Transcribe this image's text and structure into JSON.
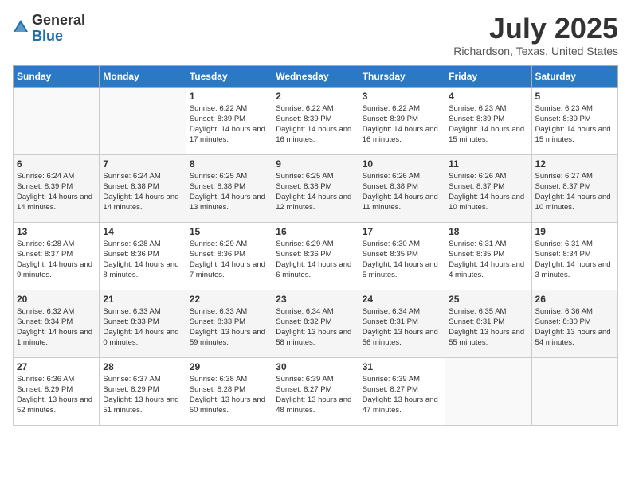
{
  "header": {
    "logo_general": "General",
    "logo_blue": "Blue",
    "month_title": "July 2025",
    "location": "Richardson, Texas, United States"
  },
  "weekdays": [
    "Sunday",
    "Monday",
    "Tuesday",
    "Wednesday",
    "Thursday",
    "Friday",
    "Saturday"
  ],
  "weeks": [
    [
      {
        "day": "",
        "info": ""
      },
      {
        "day": "",
        "info": ""
      },
      {
        "day": "1",
        "info": "Sunrise: 6:22 AM\nSunset: 8:39 PM\nDaylight: 14 hours and 17 minutes."
      },
      {
        "day": "2",
        "info": "Sunrise: 6:22 AM\nSunset: 8:39 PM\nDaylight: 14 hours and 16 minutes."
      },
      {
        "day": "3",
        "info": "Sunrise: 6:22 AM\nSunset: 8:39 PM\nDaylight: 14 hours and 16 minutes."
      },
      {
        "day": "4",
        "info": "Sunrise: 6:23 AM\nSunset: 8:39 PM\nDaylight: 14 hours and 15 minutes."
      },
      {
        "day": "5",
        "info": "Sunrise: 6:23 AM\nSunset: 8:39 PM\nDaylight: 14 hours and 15 minutes."
      }
    ],
    [
      {
        "day": "6",
        "info": "Sunrise: 6:24 AM\nSunset: 8:39 PM\nDaylight: 14 hours and 14 minutes."
      },
      {
        "day": "7",
        "info": "Sunrise: 6:24 AM\nSunset: 8:38 PM\nDaylight: 14 hours and 14 minutes."
      },
      {
        "day": "8",
        "info": "Sunrise: 6:25 AM\nSunset: 8:38 PM\nDaylight: 14 hours and 13 minutes."
      },
      {
        "day": "9",
        "info": "Sunrise: 6:25 AM\nSunset: 8:38 PM\nDaylight: 14 hours and 12 minutes."
      },
      {
        "day": "10",
        "info": "Sunrise: 6:26 AM\nSunset: 8:38 PM\nDaylight: 14 hours and 11 minutes."
      },
      {
        "day": "11",
        "info": "Sunrise: 6:26 AM\nSunset: 8:37 PM\nDaylight: 14 hours and 10 minutes."
      },
      {
        "day": "12",
        "info": "Sunrise: 6:27 AM\nSunset: 8:37 PM\nDaylight: 14 hours and 10 minutes."
      }
    ],
    [
      {
        "day": "13",
        "info": "Sunrise: 6:28 AM\nSunset: 8:37 PM\nDaylight: 14 hours and 9 minutes."
      },
      {
        "day": "14",
        "info": "Sunrise: 6:28 AM\nSunset: 8:36 PM\nDaylight: 14 hours and 8 minutes."
      },
      {
        "day": "15",
        "info": "Sunrise: 6:29 AM\nSunset: 8:36 PM\nDaylight: 14 hours and 7 minutes."
      },
      {
        "day": "16",
        "info": "Sunrise: 6:29 AM\nSunset: 8:36 PM\nDaylight: 14 hours and 6 minutes."
      },
      {
        "day": "17",
        "info": "Sunrise: 6:30 AM\nSunset: 8:35 PM\nDaylight: 14 hours and 5 minutes."
      },
      {
        "day": "18",
        "info": "Sunrise: 6:31 AM\nSunset: 8:35 PM\nDaylight: 14 hours and 4 minutes."
      },
      {
        "day": "19",
        "info": "Sunrise: 6:31 AM\nSunset: 8:34 PM\nDaylight: 14 hours and 3 minutes."
      }
    ],
    [
      {
        "day": "20",
        "info": "Sunrise: 6:32 AM\nSunset: 8:34 PM\nDaylight: 14 hours and 1 minute."
      },
      {
        "day": "21",
        "info": "Sunrise: 6:33 AM\nSunset: 8:33 PM\nDaylight: 14 hours and 0 minutes."
      },
      {
        "day": "22",
        "info": "Sunrise: 6:33 AM\nSunset: 8:33 PM\nDaylight: 13 hours and 59 minutes."
      },
      {
        "day": "23",
        "info": "Sunrise: 6:34 AM\nSunset: 8:32 PM\nDaylight: 13 hours and 58 minutes."
      },
      {
        "day": "24",
        "info": "Sunrise: 6:34 AM\nSunset: 8:31 PM\nDaylight: 13 hours and 56 minutes."
      },
      {
        "day": "25",
        "info": "Sunrise: 6:35 AM\nSunset: 8:31 PM\nDaylight: 13 hours and 55 minutes."
      },
      {
        "day": "26",
        "info": "Sunrise: 6:36 AM\nSunset: 8:30 PM\nDaylight: 13 hours and 54 minutes."
      }
    ],
    [
      {
        "day": "27",
        "info": "Sunrise: 6:36 AM\nSunset: 8:29 PM\nDaylight: 13 hours and 52 minutes."
      },
      {
        "day": "28",
        "info": "Sunrise: 6:37 AM\nSunset: 8:29 PM\nDaylight: 13 hours and 51 minutes."
      },
      {
        "day": "29",
        "info": "Sunrise: 6:38 AM\nSunset: 8:28 PM\nDaylight: 13 hours and 50 minutes."
      },
      {
        "day": "30",
        "info": "Sunrise: 6:39 AM\nSunset: 8:27 PM\nDaylight: 13 hours and 48 minutes."
      },
      {
        "day": "31",
        "info": "Sunrise: 6:39 AM\nSunset: 8:27 PM\nDaylight: 13 hours and 47 minutes."
      },
      {
        "day": "",
        "info": ""
      },
      {
        "day": "",
        "info": ""
      }
    ]
  ]
}
